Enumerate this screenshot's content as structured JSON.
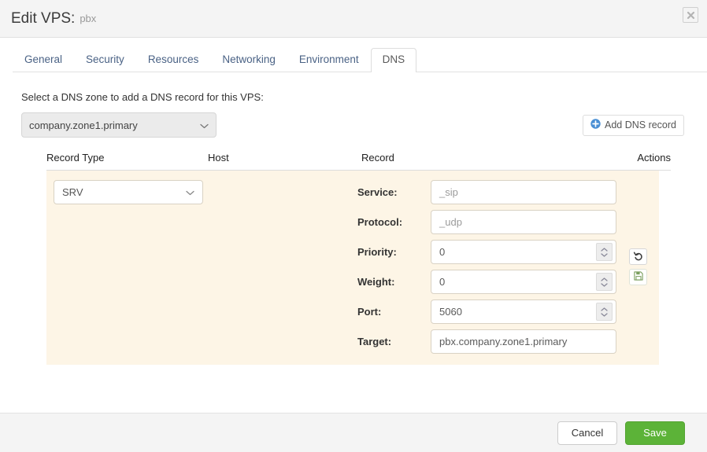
{
  "header": {
    "title": "Edit VPS:",
    "subtitle": "pbx",
    "close_icon": "close-icon"
  },
  "tabs": [
    {
      "label": "General",
      "active": false
    },
    {
      "label": "Security",
      "active": false
    },
    {
      "label": "Resources",
      "active": false
    },
    {
      "label": "Networking",
      "active": false
    },
    {
      "label": "Environment",
      "active": false
    },
    {
      "label": "DNS",
      "active": true
    }
  ],
  "dns": {
    "instruction": "Select a DNS zone to add a DNS record for this VPS:",
    "zone_select": {
      "value": "company.zone1.primary",
      "chevron_icon": "chevron-down-icon"
    },
    "add_record_button": {
      "label": "Add DNS record",
      "icon": "plus-circle-icon",
      "icon_color": "#4a8fd4"
    },
    "table": {
      "columns": [
        "Record Type",
        "Host",
        "Record",
        "Actions"
      ],
      "row": {
        "record_type": "SRV",
        "host": "",
        "fields": [
          {
            "label": "Service:",
            "value": "_sip",
            "is_placeholder": true,
            "spinner": false
          },
          {
            "label": "Protocol:",
            "value": "_udp",
            "is_placeholder": true,
            "spinner": false
          },
          {
            "label": "Priority:",
            "value": "0",
            "is_placeholder": false,
            "spinner": true
          },
          {
            "label": "Weight:",
            "value": "0",
            "is_placeholder": false,
            "spinner": true
          },
          {
            "label": "Port:",
            "value": "5060",
            "is_placeholder": false,
            "spinner": true
          },
          {
            "label": "Target:",
            "value": "pbx.company.zone1.primary",
            "is_placeholder": false,
            "spinner": false
          }
        ],
        "actions": [
          {
            "name": "revert-row-button",
            "icon": "undo-icon"
          },
          {
            "name": "save-row-button",
            "icon": "floppy-disk-icon"
          }
        ]
      },
      "row_background": "#fdf5e6"
    }
  },
  "footer": {
    "cancel_label": "Cancel",
    "save_label": "Save",
    "save_color": "#5cb338"
  }
}
